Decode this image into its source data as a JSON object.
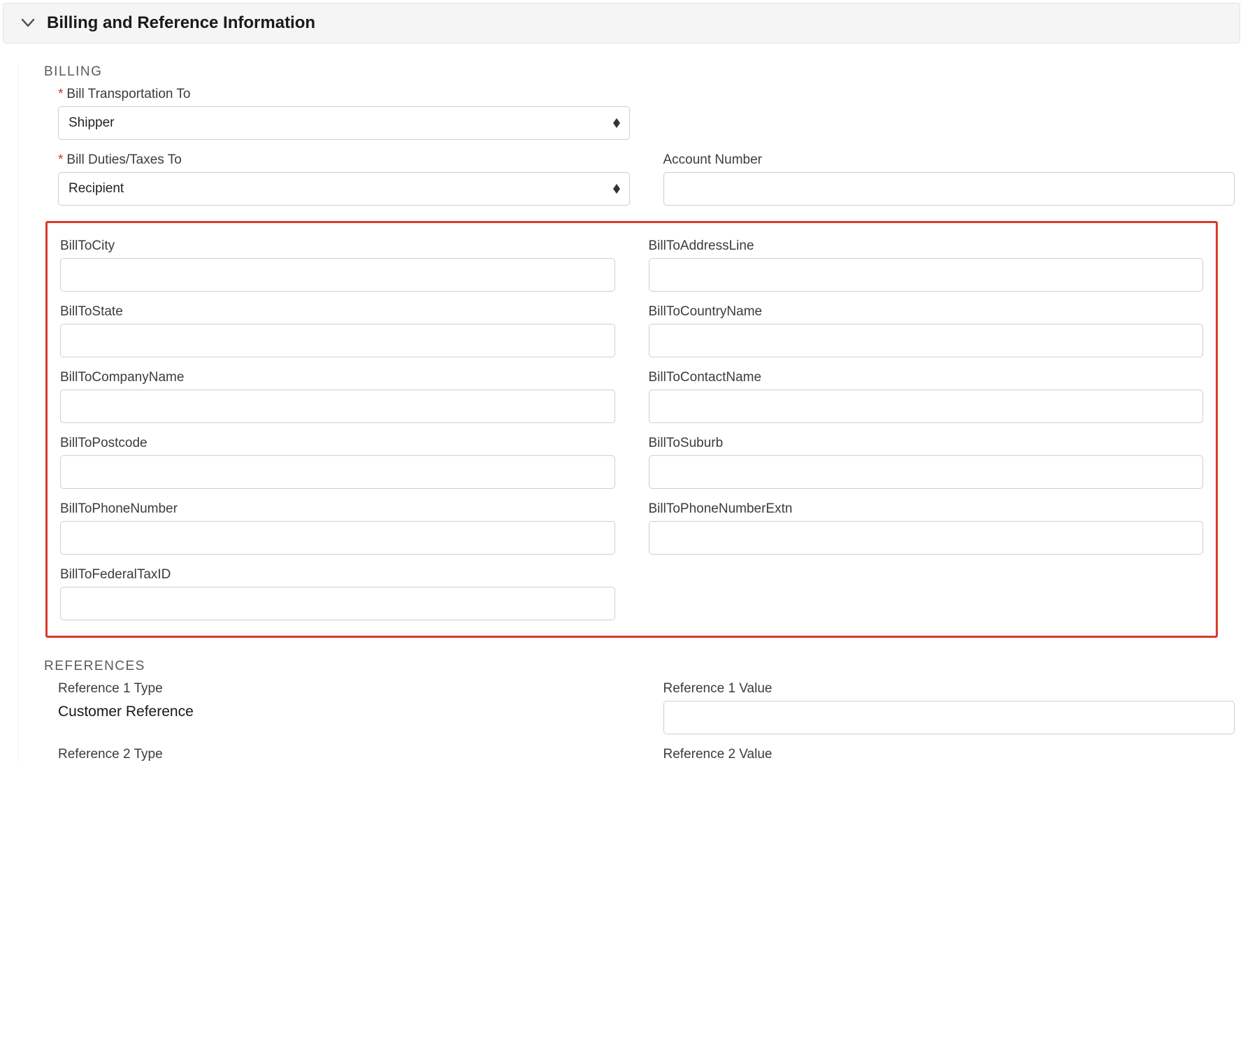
{
  "section": {
    "title": "Billing and Reference Information"
  },
  "billing": {
    "groupTitle": "BILLING",
    "billTransportationTo": {
      "label": "Bill Transportation To",
      "value": "Shipper"
    },
    "billDutiesTaxesTo": {
      "label": "Bill Duties/Taxes To",
      "value": "Recipient"
    },
    "accountNumber": {
      "label": "Account Number",
      "value": ""
    },
    "billToCity": {
      "label": "BillToCity",
      "value": ""
    },
    "billToAddressLine": {
      "label": "BillToAddressLine",
      "value": ""
    },
    "billToState": {
      "label": "BillToState",
      "value": ""
    },
    "billToCountryName": {
      "label": "BillToCountryName",
      "value": ""
    },
    "billToCompanyName": {
      "label": "BillToCompanyName",
      "value": ""
    },
    "billToContactName": {
      "label": "BillToContactName",
      "value": ""
    },
    "billToPostcode": {
      "label": "BillToPostcode",
      "value": ""
    },
    "billToSuburb": {
      "label": "BillToSuburb",
      "value": ""
    },
    "billToPhoneNumber": {
      "label": "BillToPhoneNumber",
      "value": ""
    },
    "billToPhoneNumberExtn": {
      "label": "BillToPhoneNumberExtn",
      "value": ""
    },
    "billToFederalTaxID": {
      "label": "BillToFederalTaxID",
      "value": ""
    }
  },
  "references": {
    "groupTitle": "REFERENCES",
    "reference1Type": {
      "label": "Reference 1 Type",
      "value": "Customer Reference"
    },
    "reference1Value": {
      "label": "Reference 1 Value",
      "value": ""
    },
    "reference2Type": {
      "label": "Reference 2 Type",
      "value": ""
    },
    "reference2Value": {
      "label": "Reference 2 Value",
      "value": ""
    }
  }
}
